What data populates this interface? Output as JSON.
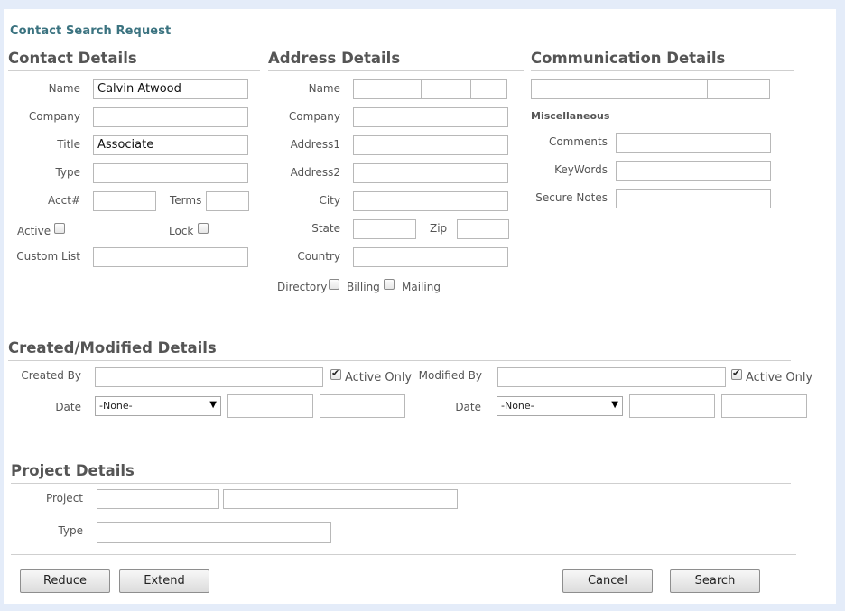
{
  "page_title": "Contact Search Request",
  "contact": {
    "heading": "Contact Details",
    "name_label": "Name",
    "name_value": "Calvin Atwood",
    "company_label": "Company",
    "company_value": "",
    "title_label": "Title",
    "title_value": "Associate",
    "type_label": "Type",
    "type_value": "",
    "acct_label": "Acct#",
    "acct_value": "",
    "terms_label": "Terms",
    "terms_value": "",
    "active_label": "Active",
    "active_checked": false,
    "lock_label": "Lock",
    "lock_checked": false,
    "custom_list_label": "Custom List",
    "custom_list_value": ""
  },
  "address": {
    "heading": "Address Details",
    "name_label": "Name",
    "company_label": "Company",
    "address1_label": "Address1",
    "address2_label": "Address2",
    "city_label": "City",
    "state_label": "State",
    "zip_label": "Zip",
    "country_label": "Country",
    "directory_label": "Directory",
    "directory_checked": false,
    "billing_label": "Billing",
    "billing_checked": false,
    "mailing_label": "Mailing"
  },
  "communication": {
    "heading": "Communication Details",
    "misc_heading": "Miscellaneous",
    "comments_label": "Comments",
    "keywords_label": "KeyWords",
    "secure_notes_label": "Secure Notes"
  },
  "created_modified": {
    "heading": "Created/Modified Details",
    "created_by_label": "Created By",
    "created_active_only_label": "Active Only",
    "created_active_only_checked": true,
    "modified_by_label": "Modified By",
    "modified_active_only_label": "Active Only",
    "modified_active_only_checked": true,
    "date_label": "Date",
    "created_date_select": "-None-",
    "modified_date_label": "Date",
    "modified_date_select": "-None-"
  },
  "project": {
    "heading": "Project Details",
    "project_label": "Project",
    "type_label": "Type"
  },
  "buttons": {
    "reduce": "Reduce",
    "extend": "Extend",
    "cancel": "Cancel",
    "search": "Search"
  },
  "colors": {
    "background": "#e4ecf9",
    "title_link": "#3b7380",
    "heading_text": "#555555"
  }
}
